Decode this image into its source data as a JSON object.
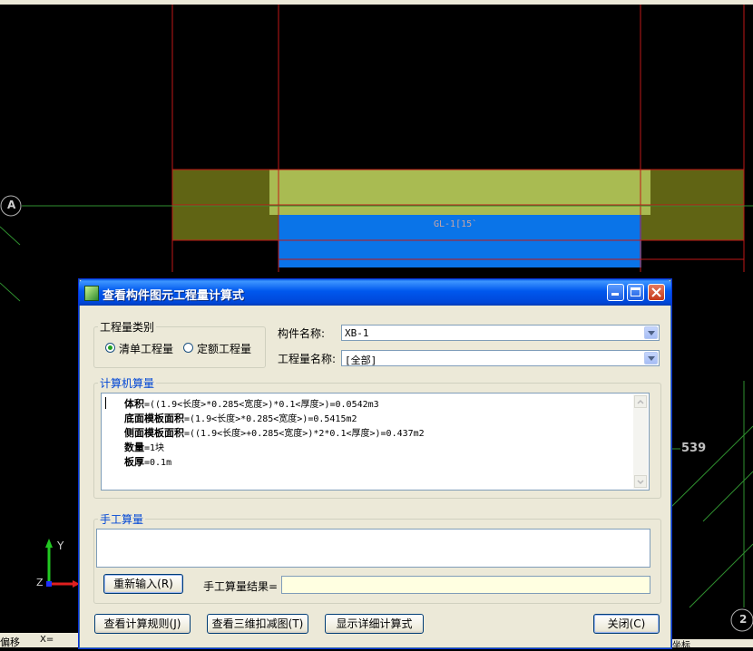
{
  "cad": {
    "beam_label": "GL-1[15`",
    "axis_a": "A",
    "axis_2": "2",
    "dimension": "539",
    "ucs_y": "Y",
    "ucs_z": "Z",
    "bottom_left_text": "偏移",
    "bottom_left_text2": "X=",
    "bottom_right_text": "坐标"
  },
  "dialog": {
    "title": "查看构件图元工程量计算式",
    "quantity_type": {
      "group_title": "工程量类别",
      "options": [
        "清单工程量",
        "定额工程量"
      ],
      "selected": "清单工程量"
    },
    "component_name_label": "构件名称:",
    "component_name_value": "XB-1",
    "quantity_name_label": "工程量名称:",
    "quantity_name_value": "[全部]",
    "computer_group_title": "计算机算量",
    "formulas": [
      {
        "name": "体积",
        "expr": "=((1.9<长度>*0.285<宽度>)*0.1<厚度>)=0.0542m3"
      },
      {
        "name": "底面模板面积",
        "expr": "=(1.9<长度>*0.285<宽度>)=0.5415m2"
      },
      {
        "name": "侧面模板面积",
        "expr": "=((1.9<长度>+0.285<宽度>)*2*0.1<厚度>)=0.437m2"
      },
      {
        "name": "数量",
        "expr": "=1块"
      },
      {
        "name": "板厚",
        "expr": "=0.1m"
      }
    ],
    "manual_group_title": "手工算量",
    "reenter_button": "重新输入(R)",
    "manual_result_label": "手工算量结果=",
    "manual_result_value": "",
    "view_rules_button": "查看计算规则(J)",
    "view_3d_button": "查看三维扣减图(T)",
    "show_detail_button": "显示详细计算式",
    "close_button": "关闭(C)"
  },
  "colors": {
    "titlebar": "#0058ee",
    "dialog_bg": "#ece9d8",
    "beam_blue": "#0a74e8",
    "slab_olive": "#a9bb52",
    "group_title": "#0046d5"
  }
}
